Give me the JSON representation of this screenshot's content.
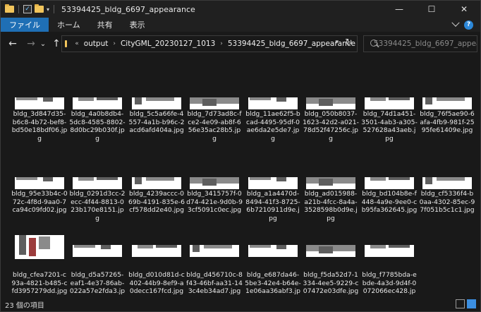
{
  "window": {
    "title": "53394425_bldg_6697_appearance",
    "controls": {
      "minimize": "—",
      "maximize": "☐",
      "close": "✕"
    }
  },
  "ribbon": {
    "tabs": [
      {
        "label": "ファイル",
        "active": true
      },
      {
        "label": "ホーム",
        "active": false
      },
      {
        "label": "共有",
        "active": false
      },
      {
        "label": "表示",
        "active": false
      }
    ],
    "help": "?"
  },
  "nav": {
    "back": "←",
    "forward": "→",
    "recent": "⌄",
    "up": "↑",
    "overflow": "«",
    "breadcrumbs": [
      "output",
      "CityGML_20230127_1013",
      "53394425_bldg_6697_appearance"
    ],
    "search_placeholder": "53394425_bldg_6697_appear..."
  },
  "files": [
    {
      "name": "bldg_3d847d35-b6c8-4b72-bef8-bd50e18bdf06.jpg",
      "thumb": "a"
    },
    {
      "name": "bldg_4a0b8db4-5dc8-4585-8802-8d0bc29b030f.jpg",
      "thumb": "b"
    },
    {
      "name": "bldg_5c5a66fe-4557-4a1b-b96c-2acd6afd404a.jpg",
      "thumb": "c"
    },
    {
      "name": "bldg_7d73ad8c-fce2-4e09-ab8f-656e35ac28b5.jpg",
      "thumb": "d"
    },
    {
      "name": "bldg_11ae62f5-bcad-4495-95df-0ae6da2e5de7.jpg",
      "thumb": "a"
    },
    {
      "name": "bldg_050b8037-1623-42d2-a021-78d52f47256c.jpg",
      "thumb": "d"
    },
    {
      "name": "bldg_74d1a451-3501-4ab3-a305-527628a43aeb.jpg",
      "thumb": "b"
    },
    {
      "name": "bldg_76f5ae90-6afa-4fb9-981f-2595fe61409e.jpg",
      "thumb": "c"
    },
    {
      "name": "bldg_95e33b4c-072c-4f8d-9aa0-7ca94c09fd02.jpg",
      "thumb": "a"
    },
    {
      "name": "bldg_0291d3cc-2ecc-4f44-8813-023b170e8151.jpg",
      "thumb": "b"
    },
    {
      "name": "bldg_4239accc-069b-4191-835e-6cf578dd2e40.jpg",
      "thumb": "c"
    },
    {
      "name": "bldg_3415757f-0d74-421e-9d0b-93cf5091c0ec.jpg",
      "thumb": "d"
    },
    {
      "name": "bldg_a1a4470d-8494-41f3-8725-6b7210911d9e.jpg",
      "thumb": "a"
    },
    {
      "name": "bldg_ad015988-a21b-4fcc-8a4a-3528598b0d9e.jpg",
      "thumb": "d"
    },
    {
      "name": "bldg_bd104b8e-f448-4a9e-9ee0-cb95fa362645.jpg",
      "thumb": "b"
    },
    {
      "name": "bldg_cf5336f4-b0aa-4302-85ec-97f051b5c1c1.jpg",
      "thumb": "c"
    },
    {
      "name": "bldg_cfea7201-c93a-4821-b485-cfd3957279dd.jpg",
      "thumb": "tall"
    },
    {
      "name": "bldg_d5a57265-eaf1-4e37-86ab-022a57e2fda3.jpg",
      "thumb": "a"
    },
    {
      "name": "bldg_d010d81d-c402-44b9-8ef9-a0decc167fcd.jpg",
      "thumb": "b"
    },
    {
      "name": "bldg_d456710c-8f43-46bf-aa31-143c4eb34ad7.jpg",
      "thumb": "c"
    },
    {
      "name": "bldg_e687da46-5be3-42e4-b64e-1e06aa36abf3.jpg",
      "thumb": "a"
    },
    {
      "name": "bldg_f5da52d7-1334-4ee5-9229-c07472e03dfe.jpg",
      "thumb": "d"
    },
    {
      "name": "bldg_f7785bda-ebde-4a3d-9d4f-0072066ec428.jpg",
      "thumb": "b"
    }
  ],
  "status": {
    "item_count": "23 個の項目"
  }
}
